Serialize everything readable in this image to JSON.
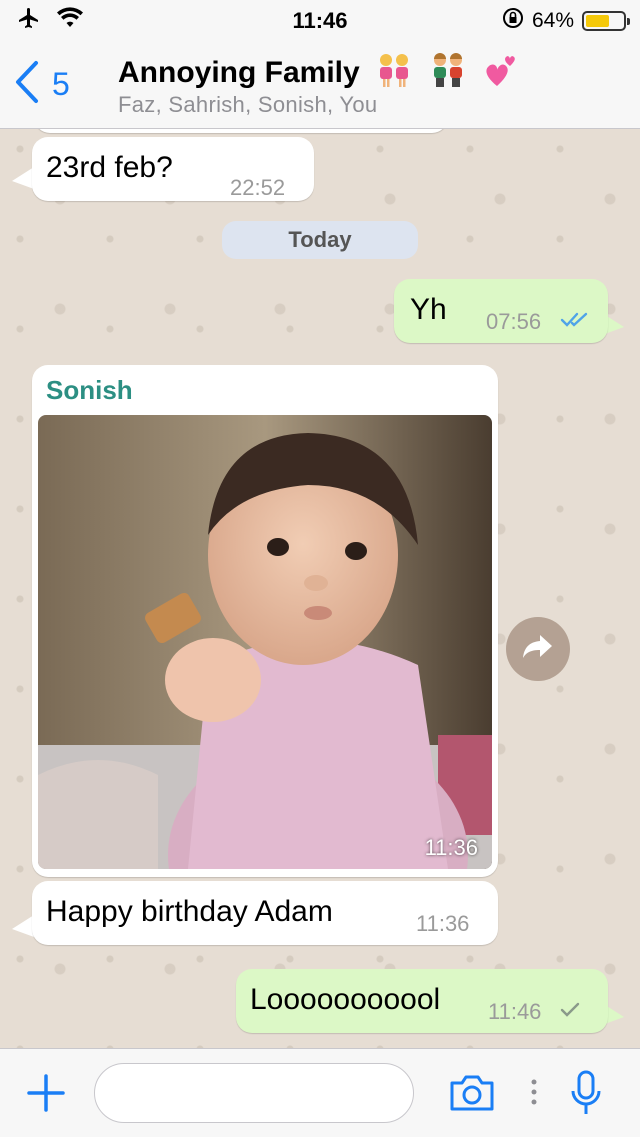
{
  "status_bar": {
    "time": "11:46",
    "battery": "64%",
    "battery_level": 0.64
  },
  "header": {
    "back_count": "5",
    "title": "Annoying Family",
    "subtitle": "Faz, Sahrish, Sonish, You"
  },
  "chat": {
    "messages": [
      {
        "direction": "incoming",
        "text": "23rd feb?",
        "time": "22:52"
      },
      {
        "direction": "outgoing",
        "text": "Yh",
        "time": "07:56",
        "status": "read"
      },
      {
        "direction": "incoming",
        "sender": "Sonish",
        "type": "photo",
        "time": "11:36"
      },
      {
        "direction": "incoming",
        "text": "Happy birthday Adam",
        "time": "11:36"
      },
      {
        "direction": "outgoing",
        "text": "Looooooooool",
        "time": "11:46",
        "status": "sent"
      }
    ],
    "date_separator": "Today"
  },
  "input_bar": {
    "placeholder": ""
  },
  "colors": {
    "accent": "#1a7ef5",
    "outgoing_bubble": "#dcf8c6",
    "incoming_bubble": "#ffffff",
    "sender_name": "#2c8f83",
    "chat_background": "#e6ddd3"
  },
  "icons": [
    "airplane-icon",
    "wifi-icon",
    "orientation-lock-icon",
    "battery-icon",
    "back-chevron-icon",
    "plus-icon",
    "camera-icon",
    "more-dots-icon",
    "microphone-icon",
    "forward-icon",
    "double-check-icon",
    "single-check-icon"
  ]
}
